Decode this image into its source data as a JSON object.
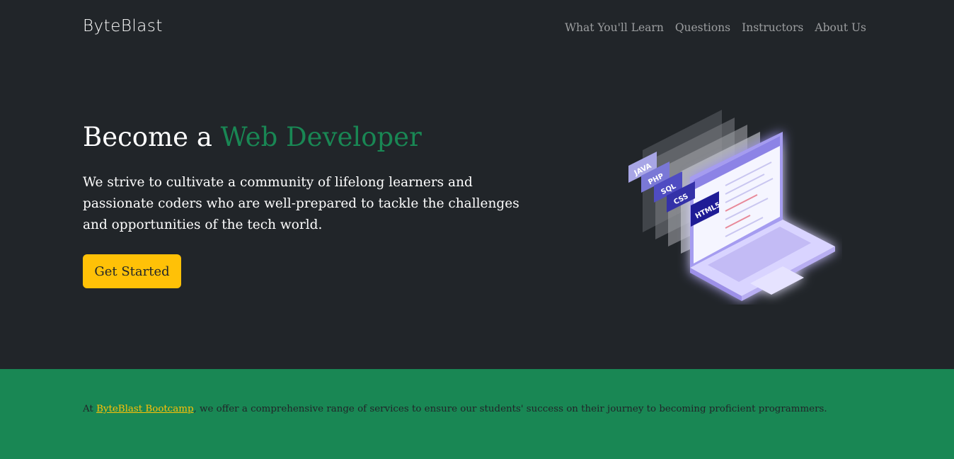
{
  "nav": {
    "brand": "ByteBlast",
    "links": [
      "What You'll Learn",
      "Questions",
      "Instructors",
      "About Us"
    ]
  },
  "hero": {
    "title_prefix": "Become a",
    "title_accent": "Web Developer",
    "lead": "We strive to cultivate a community of lifelong learners and passionate coders who are well-prepared to tackle the challenges and opportunities of the tech world.",
    "cta": "Get Started",
    "illustration_labels": [
      "JAVA",
      "PHP",
      "SQL",
      "CSS",
      "HTML5"
    ]
  },
  "info": {
    "prefix": "At",
    "link": "ByteBlast Bootcamp",
    "suffix": ", we offer a comprehensive range of services to ensure our students' success on their journey to becoming proficient programmers."
  },
  "colors": {
    "background": "#212529",
    "accent_green": "#198754",
    "button_yellow": "#ffc107"
  }
}
